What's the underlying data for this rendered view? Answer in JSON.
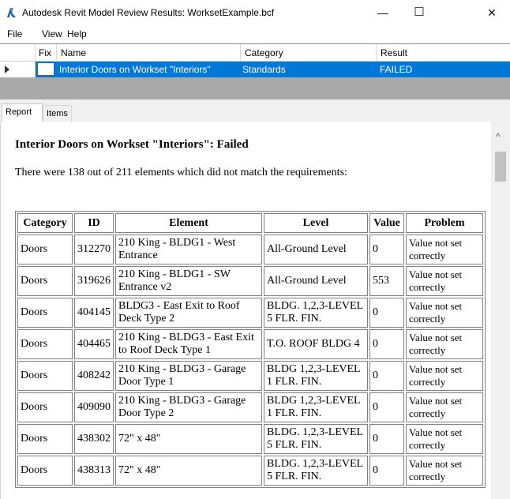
{
  "window": {
    "title": "Autodesk Revit Model Review Results: WorksetExample.bcf",
    "controls": {
      "minimize": "—",
      "maximize": "☐",
      "close": "✕"
    }
  },
  "menu": [
    "File",
    "View",
    "Help"
  ],
  "grid": {
    "columns": [
      "Fix",
      "Name",
      "Category",
      "Result"
    ],
    "row": {
      "name": "Interior Doors on Workset \"Interiors\"",
      "category": "Standards",
      "result": "FAILED"
    }
  },
  "tabs": [
    "Report",
    "Items"
  ],
  "report": {
    "title": "Interior Doors on Workset \"Interiors\": Failed",
    "summary": "There were 138 out of 211 elements which did not match the requirements:",
    "table": {
      "headers": [
        "Category",
        "ID",
        "Element",
        "Level",
        "Value",
        "Problem"
      ],
      "rows": [
        [
          "Doors",
          "312270",
          "210 King - BLDG1 - West Entrance",
          "All-Ground Level",
          "0",
          "Value not set correctly"
        ],
        [
          "Doors",
          "319626",
          "210 King - BLDG1 - SW Entrance v2",
          "All-Ground Level",
          "553",
          "Value not set correctly"
        ],
        [
          "Doors",
          "404145",
          "BLDG3 - East Exit to Roof Deck Type 2",
          "BLDG. 1,2,3-LEVEL 5 FLR. FIN.",
          "0",
          "Value not set correctly"
        ],
        [
          "Doors",
          "404465",
          "210 King - BLDG3 - East Exit to Roof Deck Type 1",
          "T.O. ROOF BLDG 4",
          "0",
          "Value not set correctly"
        ],
        [
          "Doors",
          "408242",
          "210 King - BLDG3 - Garage Door Type 1",
          "BLDG 1,2,3-LEVEL 1 FLR. FIN.",
          "0",
          "Value not set correctly"
        ],
        [
          "Doors",
          "409090",
          "210 King - BLDG3 - Garage Door Type 2",
          "BLDG 1,2,3-LEVEL 1 FLR. FIN.",
          "0",
          "Value not set correctly"
        ],
        [
          "Doors",
          "438302",
          "72\" x 48\"",
          "BLDG. 1,2,3-LEVEL 5 FLR. FIN.",
          "0",
          "Value not set correctly"
        ],
        [
          "Doors",
          "438313",
          "72\" x 48\"",
          "BLDG. 1,2,3-LEVEL 5 FLR. FIN.",
          "0",
          "Value not set correctly"
        ]
      ]
    }
  },
  "colors": {
    "selection": "#0078d7",
    "grid_background": "#a9a9a9",
    "app_icon": "#1f5fbf"
  }
}
